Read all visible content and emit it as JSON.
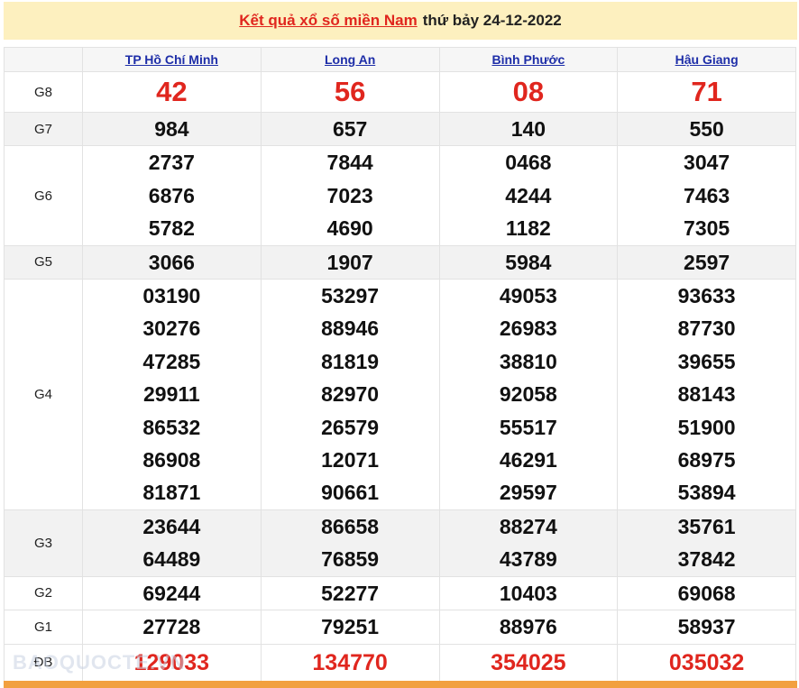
{
  "header": {
    "link_text": "Kết quả xổ số miền Nam",
    "suffix": "thứ bảy 24-12-2022"
  },
  "provinces": [
    "TP Hồ Chí Minh",
    "Long An",
    "Bình Phước",
    "Hậu Giang"
  ],
  "prizes": [
    {
      "label": "G8",
      "style": "big",
      "alt": false,
      "values": [
        [
          "42"
        ],
        [
          "56"
        ],
        [
          "08"
        ],
        [
          "71"
        ]
      ]
    },
    {
      "label": "G7",
      "style": "num",
      "alt": true,
      "values": [
        [
          "984"
        ],
        [
          "657"
        ],
        [
          "140"
        ],
        [
          "550"
        ]
      ]
    },
    {
      "label": "G6",
      "style": "num",
      "alt": false,
      "values": [
        [
          "2737",
          "6876",
          "5782"
        ],
        [
          "7844",
          "7023",
          "4690"
        ],
        [
          "0468",
          "4244",
          "1182"
        ],
        [
          "3047",
          "7463",
          "7305"
        ]
      ]
    },
    {
      "label": "G5",
      "style": "num",
      "alt": true,
      "values": [
        [
          "3066"
        ],
        [
          "1907"
        ],
        [
          "5984"
        ],
        [
          "2597"
        ]
      ]
    },
    {
      "label": "G4",
      "style": "num",
      "alt": false,
      "values": [
        [
          "03190",
          "30276",
          "47285",
          "29911",
          "86532",
          "86908",
          "81871"
        ],
        [
          "53297",
          "88946",
          "81819",
          "82970",
          "26579",
          "12071",
          "90661"
        ],
        [
          "49053",
          "26983",
          "38810",
          "92058",
          "55517",
          "46291",
          "29597"
        ],
        [
          "93633",
          "87730",
          "39655",
          "88143",
          "51900",
          "68975",
          "53894"
        ]
      ]
    },
    {
      "label": "G3",
      "style": "num",
      "alt": true,
      "values": [
        [
          "23644",
          "64489"
        ],
        [
          "86658",
          "76859"
        ],
        [
          "88274",
          "43789"
        ],
        [
          "35761",
          "37842"
        ]
      ]
    },
    {
      "label": "G2",
      "style": "num",
      "alt": false,
      "values": [
        [
          "69244"
        ],
        [
          "52277"
        ],
        [
          "10403"
        ],
        [
          "69068"
        ]
      ]
    },
    {
      "label": "G1",
      "style": "num",
      "alt": false,
      "values": [
        [
          "27728"
        ],
        [
          "79251"
        ],
        [
          "88976"
        ],
        [
          "58937"
        ]
      ]
    },
    {
      "label": "ĐB",
      "style": "db",
      "alt": false,
      "values": [
        [
          "129033"
        ],
        [
          "134770"
        ],
        [
          "354025"
        ],
        [
          "035032"
        ]
      ]
    }
  ],
  "watermark": "BAOQUOCTE.VN"
}
